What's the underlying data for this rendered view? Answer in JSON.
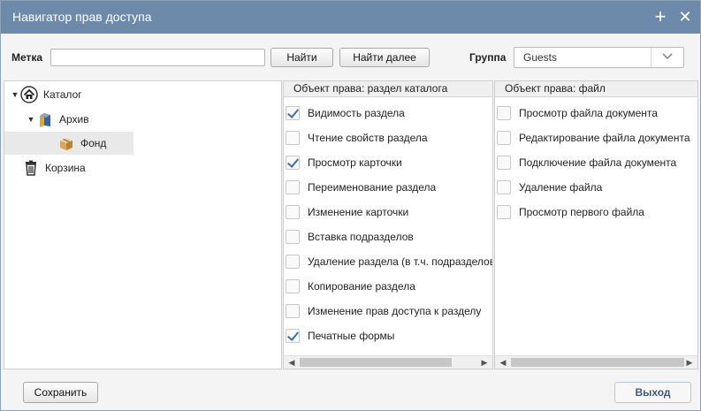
{
  "window": {
    "title": "Навигатор прав доступа"
  },
  "toolbar": {
    "label_tag": "Метка",
    "tag_value": "",
    "find_label": "Найти",
    "find_next_label": "Найти далее",
    "label_group": "Группа",
    "group_value": "Guests"
  },
  "tree": {
    "items": [
      {
        "label": "Каталог"
      },
      {
        "label": "Архив"
      },
      {
        "label": "Фонд"
      },
      {
        "label": "Корзина"
      }
    ]
  },
  "section_rights": {
    "header": "Объект права: раздел каталога",
    "items": [
      {
        "label": "Видимость раздела",
        "checked": true
      },
      {
        "label": "Чтение свойств раздела",
        "checked": false
      },
      {
        "label": "Просмотр карточки",
        "checked": true
      },
      {
        "label": "Переименование раздела",
        "checked": false
      },
      {
        "label": "Изменение карточки",
        "checked": false
      },
      {
        "label": "Вставка подразделов",
        "checked": false
      },
      {
        "label": "Удаление раздела (в т.ч. подразделов)",
        "checked": false
      },
      {
        "label": "Копирование раздела",
        "checked": false
      },
      {
        "label": "Изменение прав доступа к разделу",
        "checked": false
      },
      {
        "label": "Печатные формы",
        "checked": true
      }
    ]
  },
  "file_rights": {
    "header": "Объект права: файл",
    "items": [
      {
        "label": "Просмотр файла документа",
        "checked": false
      },
      {
        "label": "Редактирование файла документа",
        "checked": false
      },
      {
        "label": "Подключение файла документа",
        "checked": false
      },
      {
        "label": "Удаление файла",
        "checked": false
      },
      {
        "label": "Просмотр первого файла",
        "checked": false
      }
    ]
  },
  "footer": {
    "save_label": "Сохранить",
    "exit_label": "Выход"
  },
  "colors": {
    "titlebar": "#6d8aab",
    "check": "#3a6ea8"
  }
}
